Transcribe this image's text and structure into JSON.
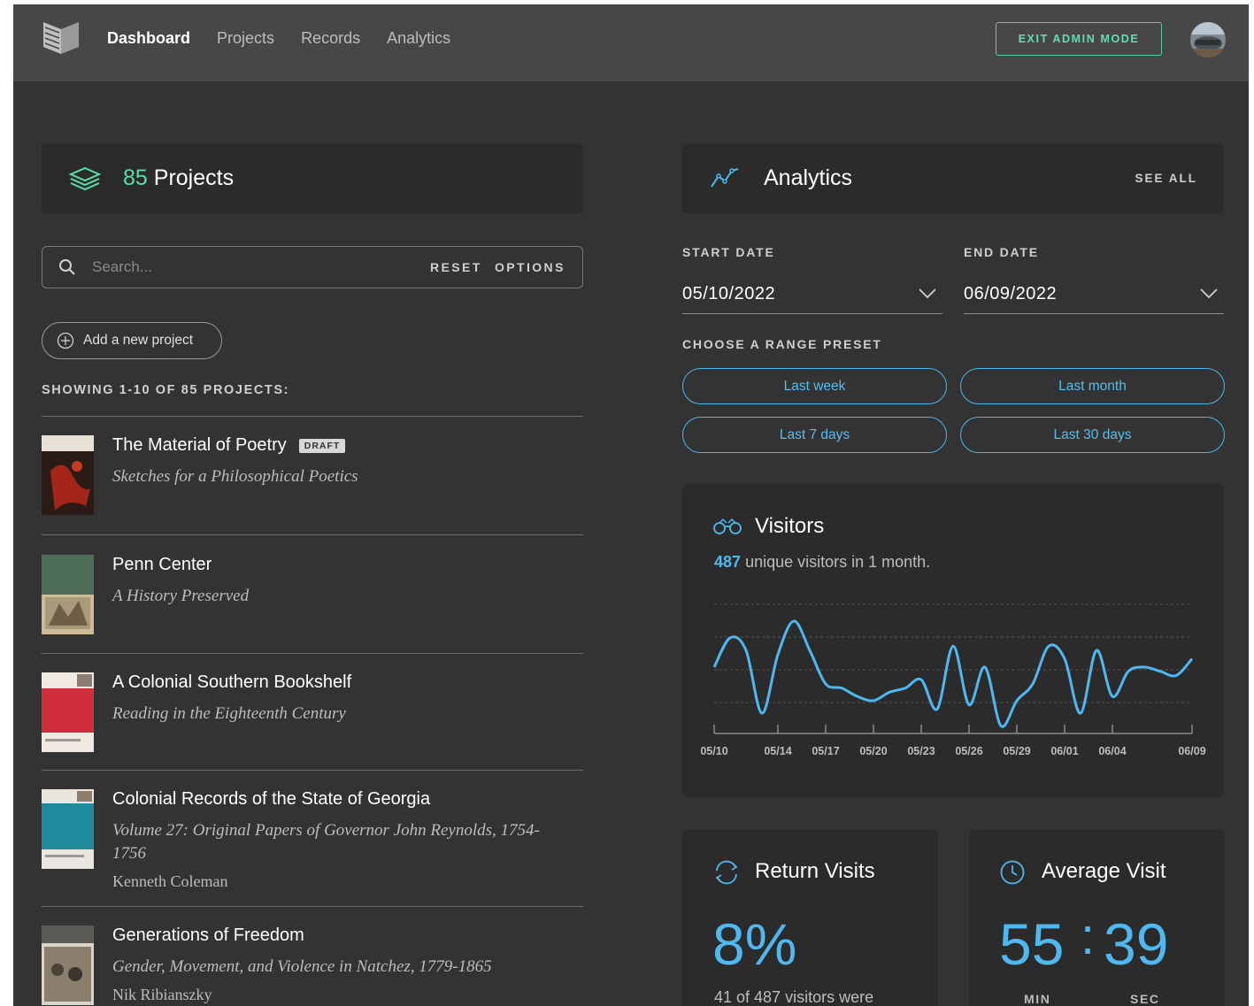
{
  "nav": {
    "items": [
      "Dashboard",
      "Projects",
      "Records",
      "Analytics"
    ],
    "active": "Dashboard",
    "exit_admin": "EXIT ADMIN MODE"
  },
  "projects": {
    "count": "85",
    "title": "Projects",
    "search_placeholder": "Search...",
    "reset": "RESET",
    "options": "OPTIONS",
    "add_label": "Add a new project",
    "showing": "SHOWING 1-10 OF 85 PROJECTS:",
    "list": [
      {
        "title": "The Material of Poetry",
        "badge": "DRAFT",
        "subtitle": "Sketches for a Philosophical Poetics",
        "author": ""
      },
      {
        "title": "Penn Center",
        "subtitle": "A History Preserved",
        "author": ""
      },
      {
        "title": "A Colonial Southern Bookshelf",
        "subtitle": "Reading in the Eighteenth Century",
        "author": ""
      },
      {
        "title": "Colonial Records of the State of Georgia",
        "subtitle": "Volume 27: Original Papers of Governor John Reynolds, 1754-1756",
        "author": "Kenneth Coleman"
      },
      {
        "title": "Generations of Freedom",
        "subtitle": "Gender, Movement, and Violence in Natchez, 1779-1865",
        "author": "Nik Ribianszky"
      }
    ]
  },
  "analytics": {
    "title": "Analytics",
    "see_all": "SEE ALL",
    "start_label": "START DATE",
    "start_value": "05/10/2022",
    "end_label": "END DATE",
    "end_value": "06/09/2022",
    "preset_label": "CHOOSE A RANGE PRESET",
    "presets": [
      "Last week",
      "Last month",
      "Last 7 days",
      "Last 30 days"
    ]
  },
  "visitors": {
    "title": "Visitors",
    "count": "487",
    "subtitle": "unique visitors in 1 month."
  },
  "chart_data": {
    "type": "line",
    "x_ticks": [
      "05/10",
      "05/14",
      "05/17",
      "05/20",
      "05/23",
      "05/26",
      "05/29",
      "06/01",
      "06/04",
      "06/09"
    ],
    "x": [
      "05/10",
      "05/11",
      "05/12",
      "05/13",
      "05/14",
      "05/15",
      "05/16",
      "05/17",
      "05/18",
      "05/19",
      "05/20",
      "05/21",
      "05/22",
      "05/23",
      "05/24",
      "05/25",
      "05/26",
      "05/27",
      "05/28",
      "05/29",
      "05/30",
      "05/31",
      "06/01",
      "06/02",
      "06/03",
      "06/04",
      "06/05",
      "06/06",
      "06/07",
      "06/08",
      "06/09"
    ],
    "series": [
      {
        "values": [
          15,
          22,
          19,
          4,
          18,
          26,
          19,
          11,
          10,
          8,
          7,
          9,
          10,
          12,
          5,
          20,
          6,
          15,
          1,
          7,
          11,
          20,
          17,
          4,
          19,
          8,
          14,
          15,
          14,
          13,
          17
        ]
      }
    ],
    "ylim": [
      0,
      30
    ],
    "grid": true,
    "color": "#4fb8f0"
  },
  "return_visits": {
    "title": "Return Visits",
    "value": "8%",
    "text": "41 of 487 visitors were"
  },
  "average_visit": {
    "title": "Average Visit",
    "minutes": "55",
    "seconds": "39",
    "min_label": "MIN",
    "sec_label": "SEC"
  },
  "colors": {
    "accent_green": "#57e0a8",
    "accent_blue": "#4fb8f0",
    "background": "#333333",
    "panel": "#2b2b2b"
  }
}
